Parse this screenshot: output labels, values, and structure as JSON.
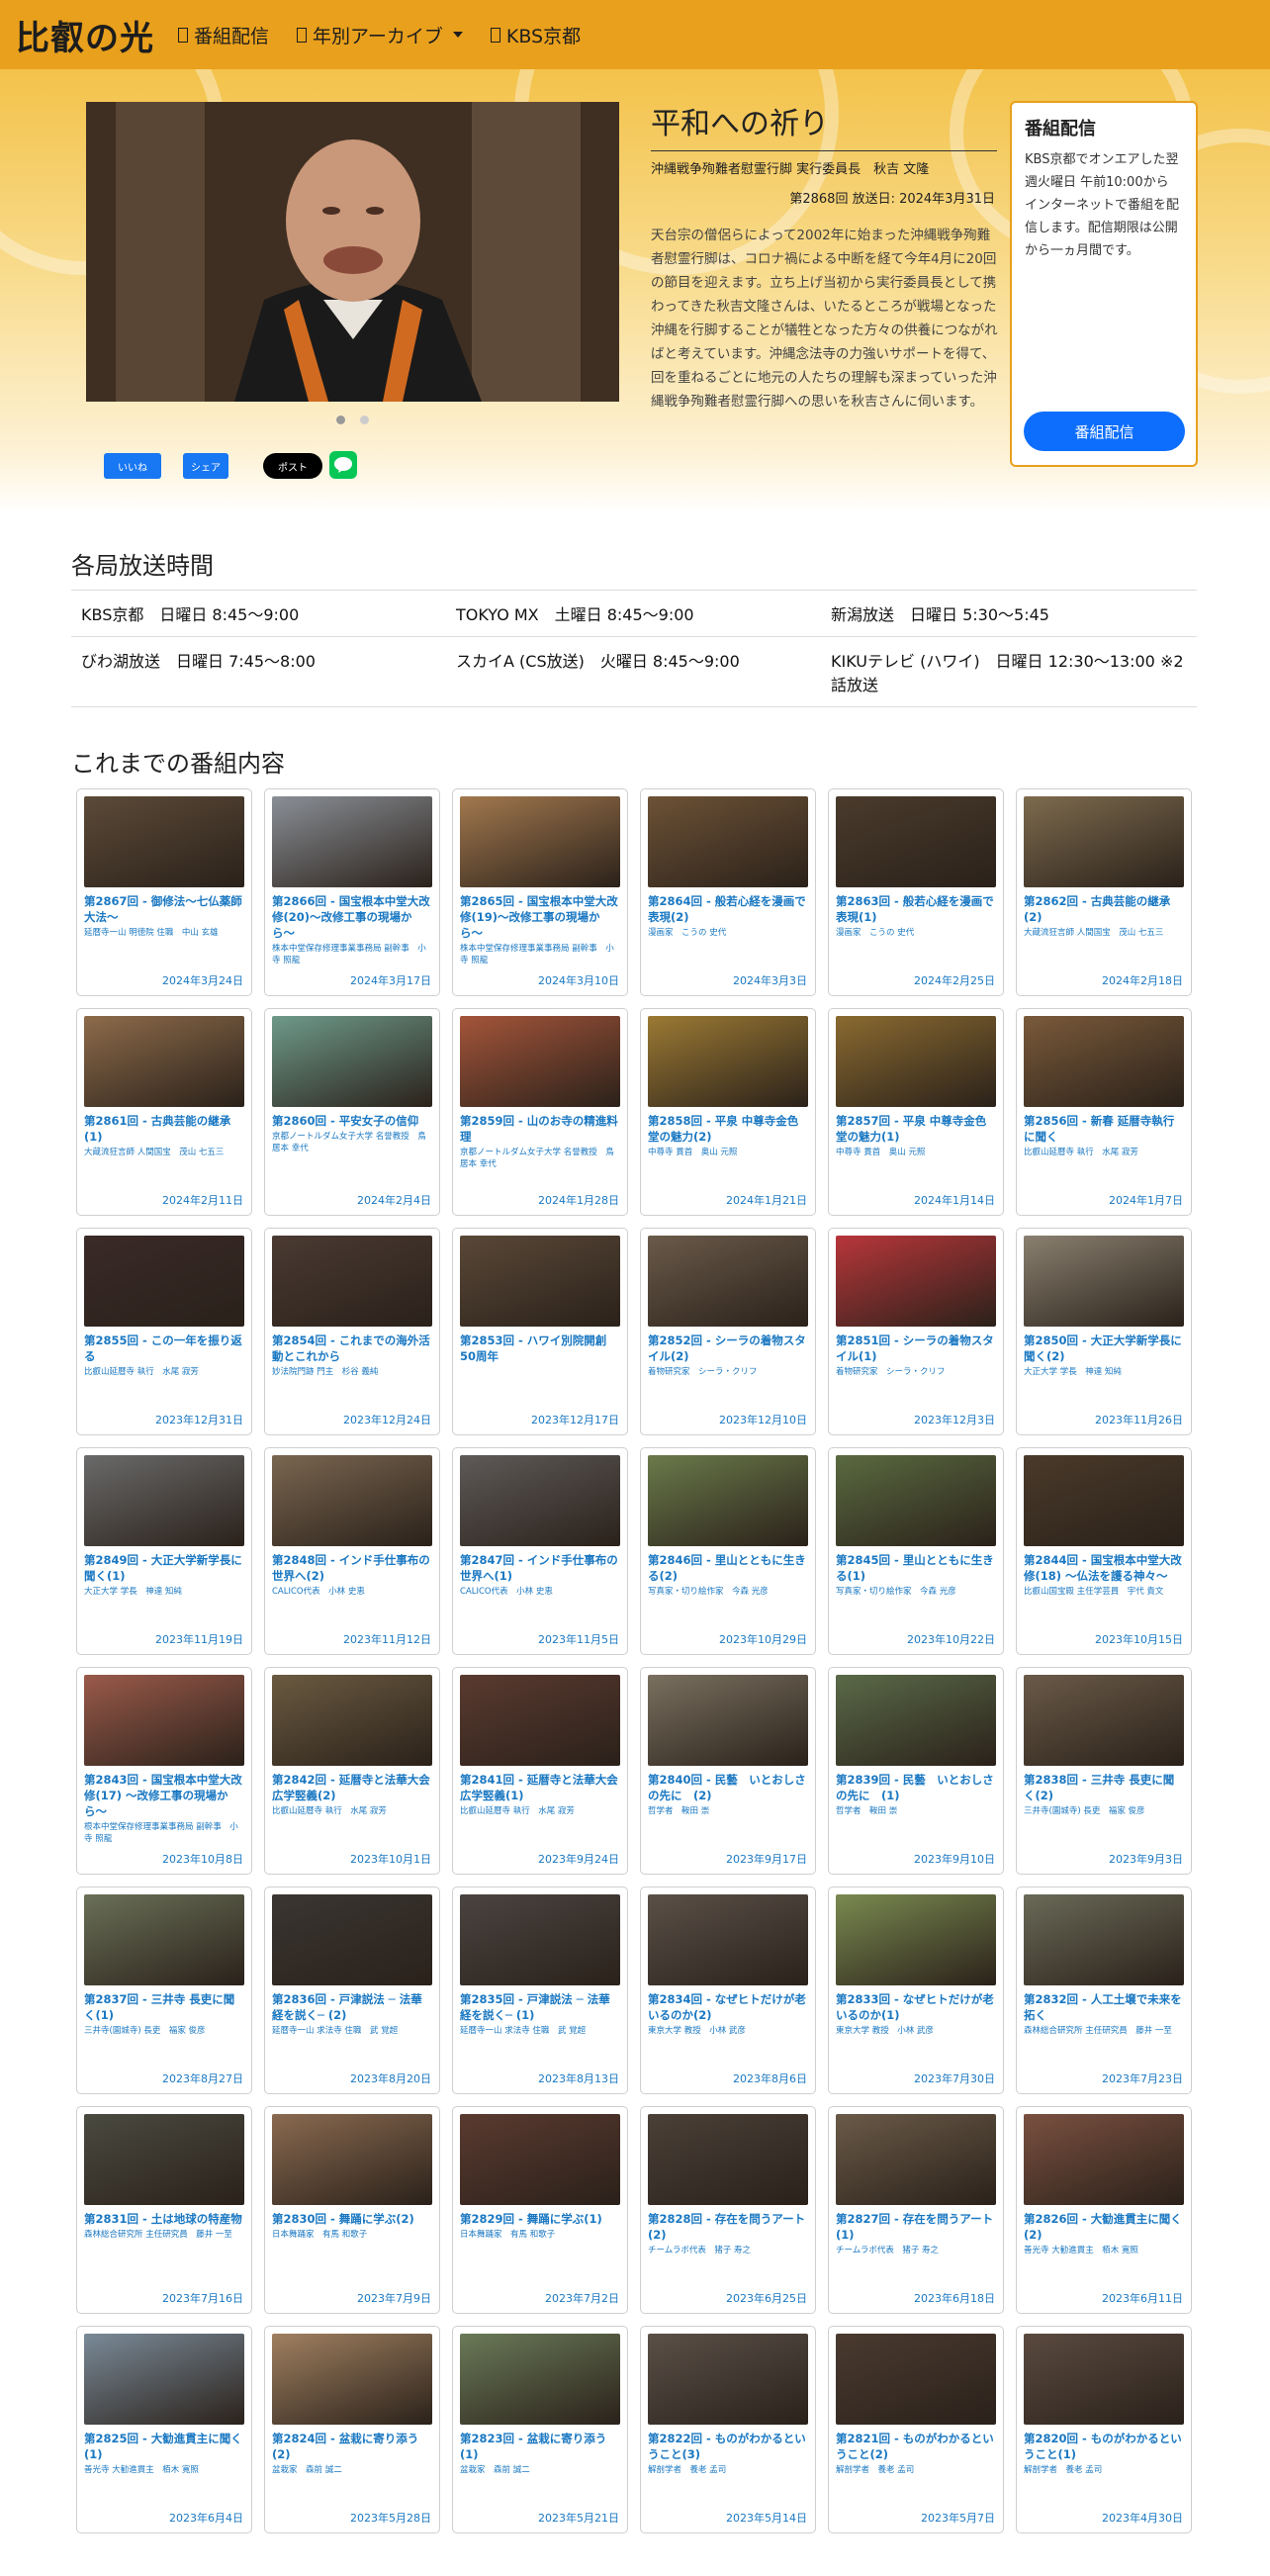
{
  "header": {
    "brand": "比叡の光",
    "nav": [
      {
        "label": "番組配信"
      },
      {
        "label": "年別アーカイブ"
      },
      {
        "label": "KBS京都"
      }
    ]
  },
  "featured": {
    "title": "平和への祈り",
    "subtitle": "沖縄戦争殉難者慰霊行脚 実行委員長　秋吉 文隆",
    "episode": "第2868回 放送日: 2024年3月31日",
    "body": "天台宗の僧侶らによって2002年に始まった沖縄戦争殉難者慰霊行脚は、コロナ禍による中断を経て今年4月に20回の節目を迎えます。立ち上げ当初から実行委員長として携わってきた秋吉文隆さんは、いたるところが戦場となった沖縄を行脚することが犠牲となった方々の供養につながればと考えています。沖縄念法寺の力強いサポートを得て、回を重ねるごとに地元の人たちの理解も深まっていった沖縄戦争殉難者慰霊行脚への思いを秋吉さんに伺います。"
  },
  "side": {
    "title": "番組配信",
    "text": "KBS京都でオンエアした翌週火曜日 午前10:00から インターネットで番組を配信します。配信期限は公開から一ヵ月間です。",
    "button": "番組配信"
  },
  "share": {
    "fb": "いいね",
    "share": "シェア",
    "x": "ポスト",
    "line": "LINE"
  },
  "broadcast": {
    "heading": "各局放送時間",
    "rows": [
      [
        "KBS京都　日曜日 8:45〜9:00",
        "TOKYO MX　土曜日 8:45〜9:00",
        "新潟放送　日曜日 5:30〜5:45"
      ],
      [
        "びわ湖放送　日曜日 7:45〜8:00",
        "スカイA (CS放送)　火曜日 8:45〜9:00",
        "KIKUテレビ (ハワイ)　日曜日 12:30〜13:00 ※2話放送"
      ]
    ]
  },
  "archive": {
    "heading": "これまでの番組内容",
    "items": [
      {
        "title": "第2867回 - 御修法〜七仏薬師大法〜",
        "guest": "延暦寺一山 明徳院 住職　中山 玄雄",
        "date": "2024年3月24日",
        "thumb": "#5c4a38"
      },
      {
        "title": "第2866回 - 国宝根本中堂大改修(20)〜改修工事の現場から〜",
        "guest": "株本中堂保存修理事業事務局 副幹事　小寺 照龍",
        "date": "2024年3月17日",
        "thumb": "#8a8f96"
      },
      {
        "title": "第2865回 - 国宝根本中堂大改修(19)〜改修工事の現場から〜",
        "guest": "株本中堂保存修理事業事務局 副幹事　小寺 照龍",
        "date": "2024年3月10日",
        "thumb": "#a2784e"
      },
      {
        "title": "第2864回 - 般若心経を漫画で表現(2)",
        "guest": "漫画家　こうの 史代",
        "date": "2024年3月3日",
        "thumb": "#6d5236"
      },
      {
        "title": "第2863回 - 般若心経を漫画で表現(1)",
        "guest": "漫画家　こうの 史代",
        "date": "2024年2月25日",
        "thumb": "#4a3b2c"
      },
      {
        "title": "第2862回 - 古典芸能の継承(2)",
        "guest": "大蔵流狂言師 人間国宝　茂山 七五三",
        "date": "2024年2月18日",
        "thumb": "#7d6b4e"
      },
      {
        "title": "第2861回 - 古典芸能の継承(1)",
        "guest": "大蔵流狂言師 人間国宝　茂山 七五三",
        "date": "2024年2月11日",
        "thumb": "#8d6b4a"
      },
      {
        "title": "第2860回 - 平安女子の信仰",
        "guest": "京都ノートルダム女子大学 名誉教授　鳥居本 幸代",
        "date": "2024年2月4日",
        "thumb": "#6e9a8a"
      },
      {
        "title": "第2859回 - 山のお寺の精進料理",
        "guest": "京都ノートルダム女子大学 名誉教授　鳥居本 幸代",
        "date": "2024年1月28日",
        "thumb": "#a4553a"
      },
      {
        "title": "第2858回 - 平泉 中尊寺金色堂の魅力(2)",
        "guest": "中尊寺 貫首　奥山 元照",
        "date": "2024年1月21日",
        "thumb": "#9c7a34"
      },
      {
        "title": "第2857回 - 平泉 中尊寺金色堂の魅力(1)",
        "guest": "中尊寺 貫首　奥山 元照",
        "date": "2024年1月14日",
        "thumb": "#8a6a30"
      },
      {
        "title": "第2856回 - 新春 延暦寺執行に聞く",
        "guest": "比叡山延暦寺 執行　水尾 寂芳",
        "date": "2024年1月7日",
        "thumb": "#7a5a3a"
      },
      {
        "title": "第2855回 - この一年を振り返る",
        "guest": "比叡山延暦寺 執行　水尾 寂芳",
        "date": "2023年12月31日",
        "thumb": "#3a2a28"
      },
      {
        "title": "第2854回 - これまでの海外活動とこれから",
        "guest": "妙法院門跡 門主　杉谷 義純",
        "date": "2023年12月24日",
        "thumb": "#4a3a32"
      },
      {
        "title": "第2853回 - ハワイ別院開創50周年",
        "guest": "",
        "date": "2023年12月17日",
        "thumb": "#5a4838"
      },
      {
        "title": "第2852回 - シーラの着物スタイル(2)",
        "guest": "着物研究家　シーラ・クリフ",
        "date": "2023年12月10日",
        "thumb": "#6a5a4a"
      },
      {
        "title": "第2851回 - シーラの着物スタイル(1)",
        "guest": "着物研究家　シーラ・クリフ",
        "date": "2023年12月3日",
        "thumb": "#b8363a"
      },
      {
        "title": "第2850回 - 大正大学新学長に聞く(2)",
        "guest": "大正大学 学長　神達 知純",
        "date": "2023年11月26日",
        "thumb": "#8a8070"
      },
      {
        "title": "第2849回 - 大正大学新学長に聞く(1)",
        "guest": "大正大学 学長　神達 知純",
        "date": "2023年11月19日",
        "thumb": "#6a6a6a"
      },
      {
        "title": "第2848回 - インド手仕事布の世界へ(2)",
        "guest": "CALICO代表　小林 史恵",
        "date": "2023年11月12日",
        "thumb": "#7a6650"
      },
      {
        "title": "第2847回 - インド手仕事布の世界へ(1)",
        "guest": "CALICO代表　小林 史恵",
        "date": "2023年11月5日",
        "thumb": "#5e5a58"
      },
      {
        "title": "第2846回 - 里山とともに生きる(2)",
        "guest": "写真家・切り絵作家　今森 光彦",
        "date": "2023年10月29日",
        "thumb": "#6a7a4a"
      },
      {
        "title": "第2845回 - 里山とともに生きる(1)",
        "guest": "写真家・切り絵作家　今森 光彦",
        "date": "2023年10月22日",
        "thumb": "#5a6a40"
      },
      {
        "title": "第2844回 - 国宝根本中堂大改修(18) 〜仏法を護る神々〜",
        "guest": "比叡山国宝殿 主任学芸員　宇代 貴文",
        "date": "2023年10月15日",
        "thumb": "#4a3a2a"
      },
      {
        "title": "第2843回 - 国宝根本中堂大改修(17) 〜改修工事の現場から〜",
        "guest": "根本中堂保存修理事業事務局 副幹事　小寺 照龍",
        "date": "2023年10月8日",
        "thumb": "#9a5a4a"
      },
      {
        "title": "第2842回 - 延暦寺と法華大会広学竪義(2)",
        "guest": "比叡山延暦寺 執行　水尾 寂芳",
        "date": "2023年10月1日",
        "thumb": "#6a5a40"
      },
      {
        "title": "第2841回 - 延暦寺と法華大会広学竪義(1)",
        "guest": "比叡山延暦寺 執行　水尾 寂芳",
        "date": "2023年9月24日",
        "thumb": "#5a3a30"
      },
      {
        "title": "第2840回 - 民藝　いとおしさの先に　(2)",
        "guest": "哲学者　鞍田 崇",
        "date": "2023年9月17日",
        "thumb": "#7a7060"
      },
      {
        "title": "第2839回 - 民藝　いとおしさの先に　(1)",
        "guest": "哲学者　鞍田 崇",
        "date": "2023年9月10日",
        "thumb": "#5a6a48"
      },
      {
        "title": "第2838回 - 三井寺 長吏に聞く(2)",
        "guest": "三井寺(園城寺) 長吏　福家 俊彦",
        "date": "2023年9月3日",
        "thumb": "#6a5a48"
      },
      {
        "title": "第2837回 - 三井寺 長吏に聞く(1)",
        "guest": "三井寺(園城寺) 長吏　福家 俊彦",
        "date": "2023年8月27日",
        "thumb": "#6a7058"
      },
      {
        "title": "第2836回 - 戸津説法 ─ 法華経を説く─ (2)",
        "guest": "延暦寺一山 求法寺 住職　武 覚超",
        "date": "2023年8月20日",
        "thumb": "#3a3632"
      },
      {
        "title": "第2835回 - 戸津説法 ─ 法華経を説く─ (1)",
        "guest": "延暦寺一山 求法寺 住職　武 覚超",
        "date": "2023年8月13日",
        "thumb": "#4a4440"
      },
      {
        "title": "第2834回 - なぜヒトだけが老いるのか(2)",
        "guest": "東京大学 教授　小林 武彦",
        "date": "2023年8月6日",
        "thumb": "#5a5048"
      },
      {
        "title": "第2833回 - なぜヒトだけが老いるのか(1)",
        "guest": "東京大学 教授　小林 武彦",
        "date": "2023年7月30日",
        "thumb": "#7a8a50"
      },
      {
        "title": "第2832回 - 人工土壌で未来を拓く",
        "guest": "森林総合研究所 主任研究員　藤井 一至",
        "date": "2023年7月23日",
        "thumb": "#6a6a58"
      },
      {
        "title": "第2831回 - 土は地球の特産物",
        "guest": "森林総合研究所 主任研究員　藤井 一至",
        "date": "2023年7月16日",
        "thumb": "#4a4a40"
      },
      {
        "title": "第2830回 - 舞踊に学ぶ(2)",
        "guest": "日本舞踊家　有馬 和歌子",
        "date": "2023年7月9日",
        "thumb": "#8a6a50"
      },
      {
        "title": "第2829回 - 舞踊に学ぶ(1)",
        "guest": "日本舞踊家　有馬 和歌子",
        "date": "2023年7月2日",
        "thumb": "#5a3a30"
      },
      {
        "title": "第2828回 - 存在を問うアート(2)",
        "guest": "チームラボ代表　猪子 寿之",
        "date": "2023年6月25日",
        "thumb": "#4a4038"
      },
      {
        "title": "第2827回 - 存在を問うアート(1)",
        "guest": "チームラボ代表　猪子 寿之",
        "date": "2023年6月18日",
        "thumb": "#6a5a48"
      },
      {
        "title": "第2826回 - 大勧進貫主に聞く(2)",
        "guest": "善光寺 大勧進貫主　栢木 寛照",
        "date": "2023年6月11日",
        "thumb": "#7a5040"
      },
      {
        "title": "第2825回 - 大勧進貫主に聞く(1)",
        "guest": "善光寺 大勧進貫主　栢木 寛照",
        "date": "2023年6月4日",
        "thumb": "#7a8a98"
      },
      {
        "title": "第2824回 - 盆栽に寄り添う(2)",
        "guest": "盆栽家　森前 誠二",
        "date": "2023年5月28日",
        "thumb": "#a08060"
      },
      {
        "title": "第2823回 - 盆栽に寄り添う(1)",
        "guest": "盆栽家　森前 誠二",
        "date": "2023年5月21日",
        "thumb": "#6a7a58"
      },
      {
        "title": "第2822回 - ものがわかるということ(3)",
        "guest": "解剖学者　養老 孟司",
        "date": "2023年5月14日",
        "thumb": "#5a5048"
      },
      {
        "title": "第2821回 - ものがわかるということ(2)",
        "guest": "解剖学者　養老 孟司",
        "date": "2023年5月7日",
        "thumb": "#4a3a30"
      },
      {
        "title": "第2820回 - ものがわかるということ(1)",
        "guest": "解剖学者　養老 孟司",
        "date": "2023年4月30日",
        "thumb": "#5a4a40"
      }
    ]
  }
}
